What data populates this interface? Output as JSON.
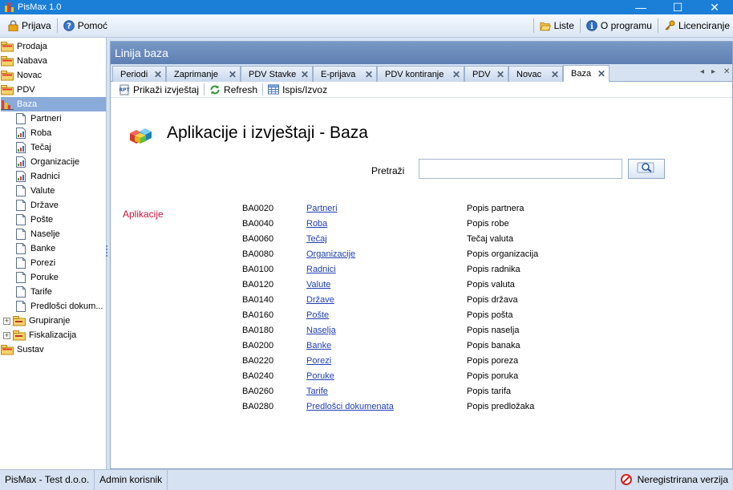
{
  "window": {
    "title": "PisMax 1.0",
    "minimize_glyph": "—",
    "maximize_glyph": "☐",
    "close_glyph": "✕"
  },
  "menubar": {
    "prijava": "Prijava",
    "pomoc": "Pomoć",
    "liste": "Liste",
    "o_programu": "O programu",
    "licenciranje": "Licenciranje"
  },
  "sidebar": {
    "nodes": [
      {
        "label": "Prodaja",
        "icon": "folder-module-icon"
      },
      {
        "label": "Nabava",
        "icon": "folder-module-icon"
      },
      {
        "label": "Novac",
        "icon": "folder-module-icon"
      },
      {
        "label": "PDV",
        "icon": "folder-module-icon"
      },
      {
        "label": "Baza",
        "icon": "database-module-icon",
        "selected": true
      },
      {
        "label": "Partneri",
        "icon": "document-icon"
      },
      {
        "label": "Roba",
        "icon": "report-icon"
      },
      {
        "label": "Tečaj",
        "icon": "report-icon"
      },
      {
        "label": "Organizacije",
        "icon": "report-icon"
      },
      {
        "label": "Radnici",
        "icon": "report-icon"
      },
      {
        "label": "Valute",
        "icon": "document-icon"
      },
      {
        "label": "Države",
        "icon": "document-icon"
      },
      {
        "label": "Pošte",
        "icon": "document-icon"
      },
      {
        "label": "Naselje",
        "icon": "document-icon"
      },
      {
        "label": "Banke",
        "icon": "document-icon"
      },
      {
        "label": "Porezi",
        "icon": "document-icon"
      },
      {
        "label": "Poruke",
        "icon": "document-icon"
      },
      {
        "label": "Tarife",
        "icon": "document-icon"
      },
      {
        "label": "Predlošci dokum...",
        "icon": "document-icon"
      },
      {
        "label": "Grupiranje",
        "icon": "folder-icon",
        "expander": "+"
      },
      {
        "label": "Fiskalizacija",
        "icon": "folder-icon",
        "expander": "+"
      },
      {
        "label": "Sustav",
        "icon": "folder-module-icon"
      }
    ]
  },
  "panel": {
    "title": "Linija baza"
  },
  "tabs": [
    {
      "label": "Periodi",
      "close": "✕"
    },
    {
      "label": "Zaprimanje",
      "close": "✕"
    },
    {
      "label": "PDV Stavke",
      "close": "✕"
    },
    {
      "label": "E-prijava",
      "close": "✕"
    },
    {
      "label": "PDV kontiranje",
      "close": "✕"
    },
    {
      "label": "PDV",
      "close": "✕"
    },
    {
      "label": "Novac",
      "close": "✕"
    },
    {
      "label": "Baza",
      "close": "✕",
      "active": true
    }
  ],
  "tab_nav": {
    "left": "◂",
    "right": "▸",
    "close": "✕"
  },
  "toolbar": {
    "prikazi": "Prikaži izvještaj",
    "refresh": "Refresh",
    "ispis": "Ispis/Izvoz"
  },
  "content": {
    "heading": "Aplikacije i izvještaji - Baza",
    "search_label": "Pretraži",
    "search_value": "",
    "apps_label": "Aplikacije",
    "rows": [
      {
        "code": "BA0020",
        "name": "Partneri",
        "desc": "Popis partnera"
      },
      {
        "code": "BA0040",
        "name": "Roba",
        "desc": "Popis robe"
      },
      {
        "code": "BA0060",
        "name": "Tečaj",
        "desc": "Tečaj valuta"
      },
      {
        "code": "BA0080",
        "name": "Organizacije",
        "desc": "Popis organizacija"
      },
      {
        "code": "BA0100",
        "name": "Radnici",
        "desc": "Popis radnika"
      },
      {
        "code": "BA0120",
        "name": "Valute",
        "desc": "Popis valuta"
      },
      {
        "code": "BA0140",
        "name": "Države",
        "desc": "Popis država"
      },
      {
        "code": "BA0160",
        "name": "Pošte",
        "desc": "Popis pošta"
      },
      {
        "code": "BA0180",
        "name": "Naselja",
        "desc": "Popis naselja"
      },
      {
        "code": "BA0200",
        "name": "Banke",
        "desc": "Popis banaka"
      },
      {
        "code": "BA0220",
        "name": "Porezi",
        "desc": "Popis poreza"
      },
      {
        "code": "BA0240",
        "name": "Poruke",
        "desc": "Popis poruka"
      },
      {
        "code": "BA0260",
        "name": "Tarife",
        "desc": "Popis tarifa"
      },
      {
        "code": "BA0280",
        "name": "Predlošci dokumenata",
        "desc": "Popis predložaka"
      }
    ]
  },
  "statusbar": {
    "company": "PisMax - Test d.o.o.",
    "user": "Admin korisnik",
    "registration": "Neregistrirana verzija"
  }
}
